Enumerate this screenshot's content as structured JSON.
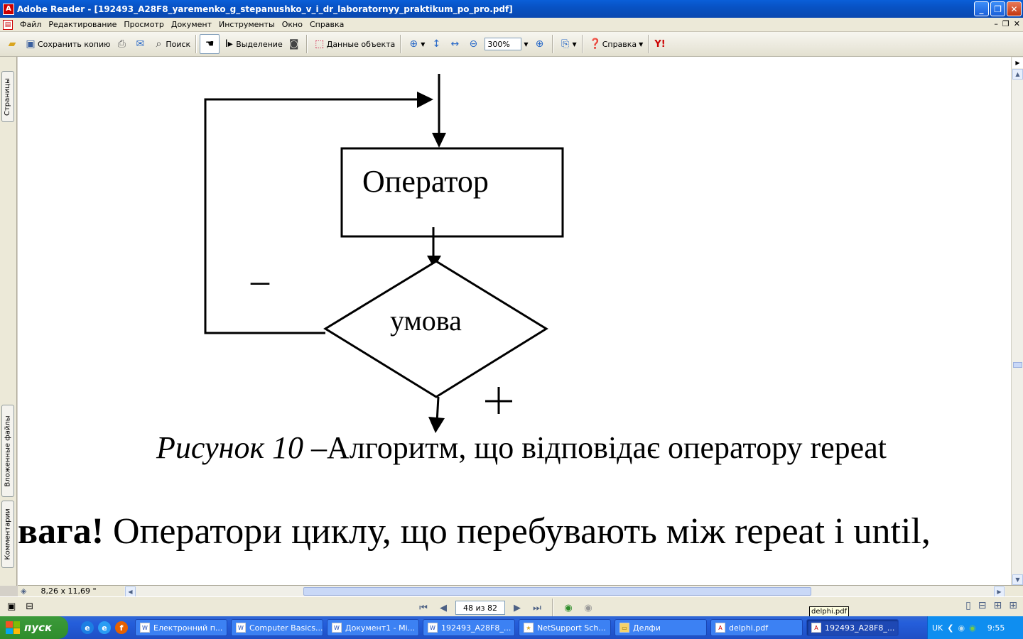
{
  "window": {
    "title": "Adobe Reader - [192493_A28F8_yaremenko_g_stepanushko_v_i_dr_laboratornyy_praktikum_po_pro.pdf]"
  },
  "menu": {
    "items": [
      "Файл",
      "Редактирование",
      "Просмотр",
      "Документ",
      "Инструменты",
      "Окно",
      "Справка"
    ]
  },
  "toolbar": {
    "save_copy": "Сохранить копию",
    "search": "Поиск",
    "select": "Выделение",
    "object_data": "Данные объекта",
    "zoom": "300%",
    "help": "Справка",
    "yahoo": "Y!"
  },
  "side_tabs": {
    "pages": "Страницы",
    "attachments": "Вложенные файлы",
    "comments": "Комментарии"
  },
  "document": {
    "box_label": "Оператор",
    "diamond_label": "умова",
    "minus_sign": "–",
    "plus_sign": "+",
    "caption_italic": "Рисунок 10 –",
    "caption_text": "Алгоритм, що відповідає оператору repeat",
    "note_bold": "вага!",
    "note_text": " Оператори циклу, що перебувають між repeat і until,"
  },
  "status": {
    "page_size": "8,26 x 11,69 \""
  },
  "nav": {
    "page": "48 из 82"
  },
  "taskbar": {
    "start": "пуск",
    "tasks": [
      "Електронний п...",
      "Computer Basics...",
      "Документ1 - Mi...",
      "192493_A28F8_...",
      "NetSupport Sch...",
      "Делфи",
      "delphi.pdf",
      "192493_A28F8_..."
    ],
    "lang": "UK",
    "clock": "9:55"
  },
  "tooltip": "delphi.pdf",
  "colors": {
    "title_blue": "#0852c4",
    "taskbar_blue": "#245edb",
    "start_green": "#3c9a3a"
  }
}
